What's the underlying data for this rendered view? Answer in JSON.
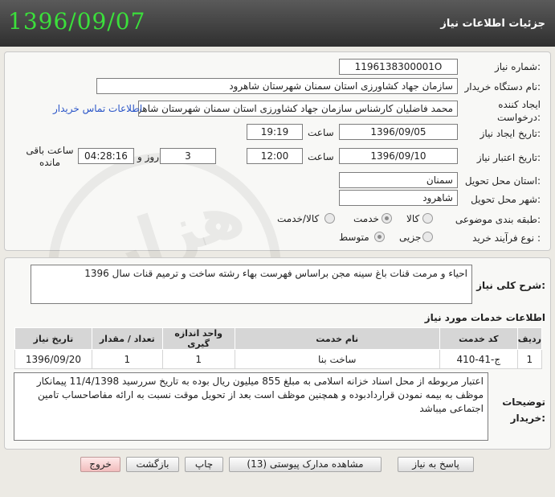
{
  "header": {
    "date": "1396/09/07",
    "title": "جزئیات اطلاعات نیاز"
  },
  "form": {
    "need_number_label": "شماره نیاز:",
    "need_number": "1196138300001O",
    "buyer_label": "نام دستگاه خریدار:",
    "buyer": "سازمان جهاد کشاورزی استان سمنان شهرستان شاهرود",
    "creator_label": "ایجاد کننده درخواست:",
    "creator": "محمد  فاضلیان  کارشناس  سازمان جهاد کشاورزی استان سمنان شهرستان شاهرود",
    "contact_link": "اطلاعات تماس خریدار",
    "announce_date_label": "تاریخ ایجاد نیاز:",
    "announce_date": "1396/09/05",
    "time_label": "ساعت",
    "announce_time": "19:19",
    "validity_label": "تاریخ اعتبار نیاز:",
    "validity_date": "1396/09/10",
    "validity_time": "12:00",
    "days": "3",
    "days_label": "روز و",
    "remaining_time": "04:28:16",
    "remaining_label": "ساعت باقی مانده",
    "province_label": "استان محل تحویل:",
    "province": "سمنان",
    "city_label": "شهر محل تحویل:",
    "city": "شاهرود",
    "category_label": "طبقه بندی موضوعی:",
    "category_options": [
      "کالا",
      "خدمت",
      "کالا/خدمت"
    ],
    "category_selected": "خدمت",
    "process_label": "نوع فرآیند خرید :",
    "process_options": [
      "جزیی",
      "متوسط"
    ],
    "process_selected": "متوسط"
  },
  "summary": {
    "label": "شرح کلی نیاز:",
    "text": "احیاء و مرمت قنات باغ سینه مجن براساس فهرست بهاء رشته ساخت و ترمیم قنات سال 1396"
  },
  "services": {
    "title": "اطلاعات خدمات مورد نیاز",
    "headers": [
      "ردیف",
      "کد خدمت",
      "نام خدمت",
      "واحد اندازه گیری",
      "تعداد / مقدار",
      "تاریخ نیاز"
    ],
    "rows": [
      [
        "1",
        "ج-41-410",
        "ساخت بنا",
        "1",
        "1",
        "1396/09/20"
      ]
    ]
  },
  "buyer_notes": {
    "label": "توضیحات خریدار:",
    "text": "اعتبار مربوطه از محل اسناد خزانه اسلامی به مبلغ 855 میلیون ریال بوده به تاریخ سررسید 11/4/1398 پیمانکار موظف به بیمه نمودن قراردادبوده و همچنین موظف است بعد از تحویل موقت نسبت به ارائه مفاصاحساب تامین اجتماعی میباشد"
  },
  "buttons": {
    "reply": "پاسخ به نیاز",
    "docs": "مشاهده مدارک پیوستی (13)",
    "print": "چاپ",
    "back": "بازگشت",
    "exit": "خروج"
  },
  "watermark": "هزاره"
}
